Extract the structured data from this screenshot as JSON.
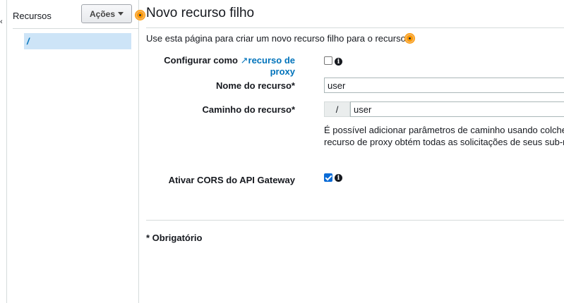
{
  "sidebar": {
    "edge_glyph": "‹",
    "title": "Recursos",
    "actions_label": "Ações",
    "items": [
      {
        "label": "/"
      }
    ]
  },
  "main": {
    "title": "Novo recurso filho",
    "intro": "Use esta página para criar um novo recurso filho para o recurso .",
    "proxy": {
      "label_prefix": "Configurar como",
      "link_text": "recurso de proxy",
      "checked": false
    },
    "resource_name": {
      "label": "Nome do recurso*",
      "value": "user"
    },
    "resource_path": {
      "label": "Caminho do recurso*",
      "prefix": "/",
      "value": "user"
    },
    "path_help": [
      "É possível adicionar parâmetros de caminho usando colchet",
      "recurso de proxy obtém todas as solicitações de seus sub-re"
    ],
    "cors": {
      "label": "Ativar CORS do API Gateway",
      "checked": true
    },
    "required_note": "* Obrigatório"
  },
  "icons": {
    "info": "info-icon",
    "external_link": "external-link-icon",
    "help_marker": "help-dot-icon"
  },
  "colors": {
    "link": "#0073bb",
    "selected_row": "#cde4f7",
    "help_marker": "#ff9900",
    "checkbox_checked": "#0a6bd6"
  }
}
